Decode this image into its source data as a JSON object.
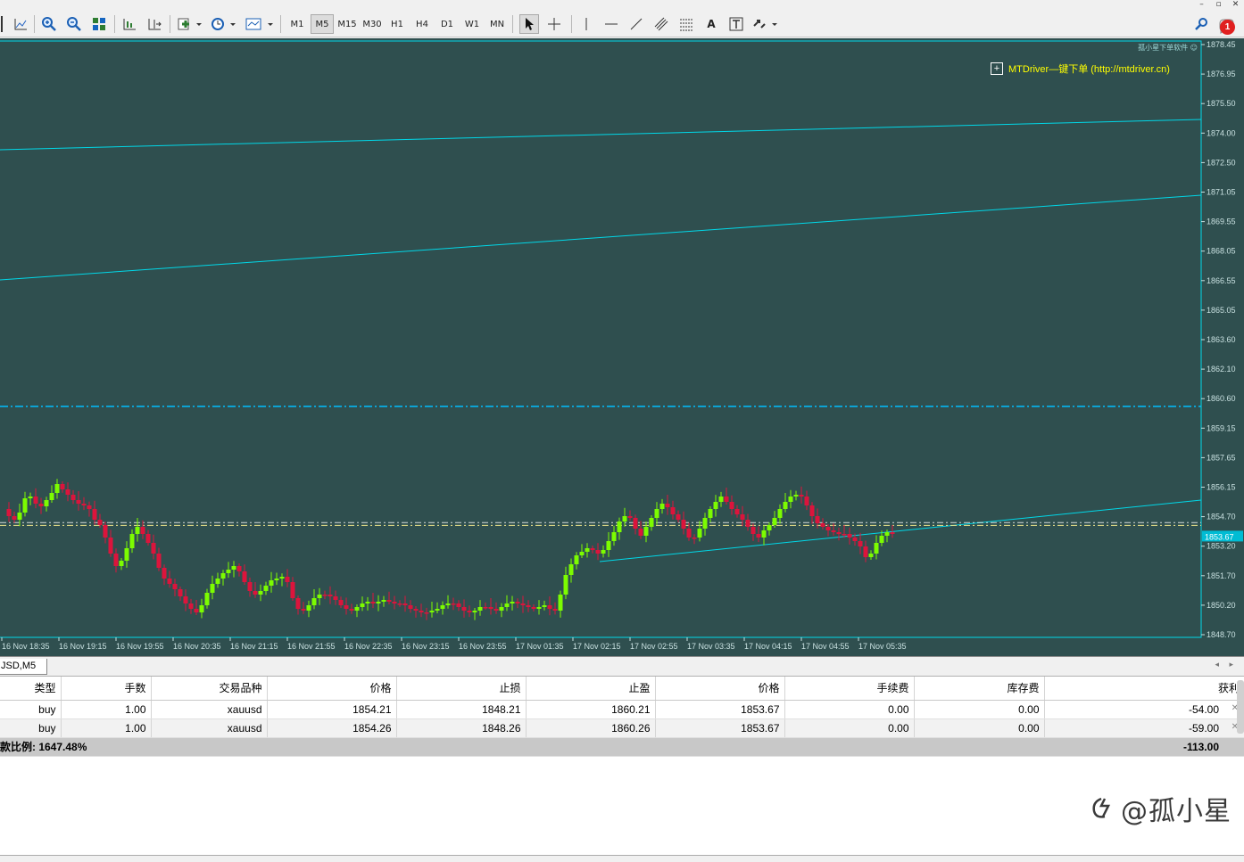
{
  "window": {
    "minimize": "–",
    "restore": "▫",
    "close": "✕"
  },
  "toolbar": {
    "timeframes": [
      "M1",
      "M5",
      "M15",
      "M30",
      "H1",
      "H4",
      "D1",
      "W1",
      "MN"
    ],
    "active_timeframe": "M5",
    "text_tool": "A",
    "notification_count": "1"
  },
  "chart": {
    "ea_label": "孤小星下单软件",
    "mtdriver_label": "MTDriver—键下单 (http://mtdriver.cn)",
    "price_ticks": [
      "1878.45",
      "1876.95",
      "1875.50",
      "1874.00",
      "1872.50",
      "1871.05",
      "1869.55",
      "1868.05",
      "1866.55",
      "1865.05",
      "1863.60",
      "1862.10",
      "1860.60",
      "1859.15",
      "1857.65",
      "1856.15",
      "1854.70",
      "1853.20",
      "1851.70",
      "1850.20",
      "1848.70"
    ],
    "current_price": "1853.67",
    "time_ticks": [
      "16 Nov 18:35",
      "16 Nov 19:15",
      "16 Nov 19:55",
      "16 Nov 20:35",
      "16 Nov 21:15",
      "16 Nov 21:55",
      "16 Nov 22:35",
      "16 Nov 23:15",
      "16 Nov 23:55",
      "17 Nov 01:35",
      "17 Nov 02:15",
      "17 Nov 02:55",
      "17 Nov 03:35",
      "17 Nov 04:15",
      "17 Nov 04:55",
      "17 Nov 05:35"
    ],
    "colors": {
      "background": "#2f4f4f",
      "bull": "#7cfc00",
      "bear": "#dc143c",
      "grid_text": "#c8e0e0",
      "trendline": "#00d8e8",
      "tp_line": "#00bfff",
      "entry_line": "#f0e68c"
    }
  },
  "chart_tab": {
    "label": "JSD,M5"
  },
  "terminal": {
    "columns": [
      "类型",
      "手数",
      "交易品种",
      "价格",
      "止损",
      "止盈",
      "价格",
      "手续费",
      "库存费",
      "获利"
    ],
    "rows": [
      [
        "buy",
        "1.00",
        "xauusd",
        "1854.21",
        "1848.21",
        "1860.21",
        "1853.67",
        "0.00",
        "0.00",
        "-54.00"
      ],
      [
        "buy",
        "1.00",
        "xauusd",
        "1854.26",
        "1848.26",
        "1860.26",
        "1853.67",
        "0.00",
        "0.00",
        "-59.00"
      ]
    ],
    "summary_label": "款比例: 1647.48%",
    "summary_total": "-113.00"
  },
  "watermark": {
    "text": "@孤小星"
  }
}
